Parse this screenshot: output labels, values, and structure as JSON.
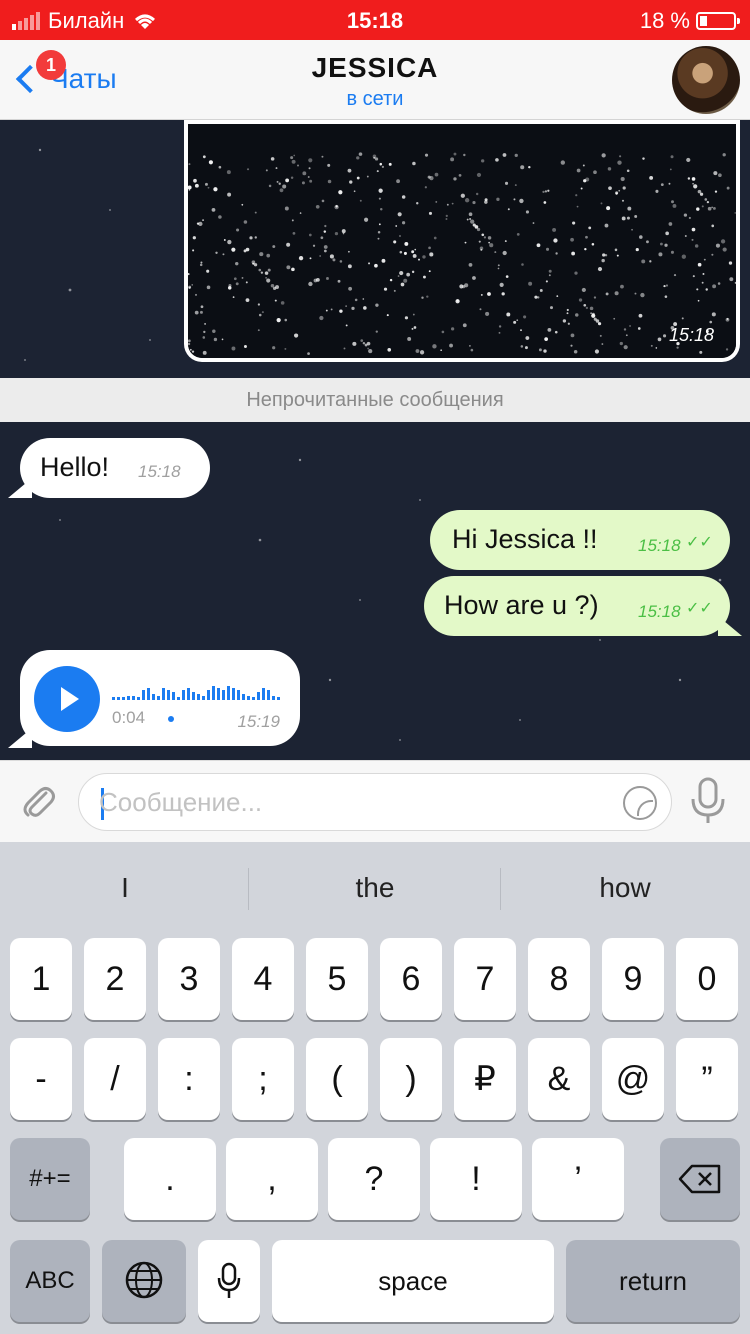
{
  "status_bar": {
    "carrier": "Билайн",
    "time": "15:18",
    "battery": "18 %"
  },
  "nav": {
    "back_label": "Чаты",
    "badge": "1",
    "title": "JESSICA",
    "subtitle": "в сети"
  },
  "chat": {
    "photo_time": "15:18",
    "unread_label": "Непрочитанные сообщения",
    "messages": [
      {
        "direction": "in",
        "text": "Hello!",
        "time": "15:18"
      },
      {
        "direction": "out",
        "text": "Hi Jessica !!",
        "time": "15:18"
      },
      {
        "direction": "out",
        "text": "How are u ?)",
        "time": "15:18"
      }
    ],
    "voice": {
      "duration": "0:04",
      "time": "15:19"
    }
  },
  "input": {
    "placeholder": "Сообщение..."
  },
  "keyboard": {
    "suggestions": [
      "I",
      "the",
      "how"
    ],
    "row1": [
      "1",
      "2",
      "3",
      "4",
      "5",
      "6",
      "7",
      "8",
      "9",
      "0"
    ],
    "row2": [
      "-",
      "/",
      ":",
      ";",
      "(",
      ")",
      "₽",
      "&",
      "@",
      "”"
    ],
    "row3": {
      "shift": "#+=",
      "keys": [
        ".",
        ",",
        "?",
        "!",
        "’"
      ]
    },
    "row4": {
      "abc": "ABC",
      "space": "space",
      "return": "return"
    }
  },
  "colors": {
    "status_bar": "#f01d1d",
    "accent": "#1b7cf1",
    "outgoing_bubble": "#e3f9c8",
    "chat_background": "#1c2333"
  }
}
